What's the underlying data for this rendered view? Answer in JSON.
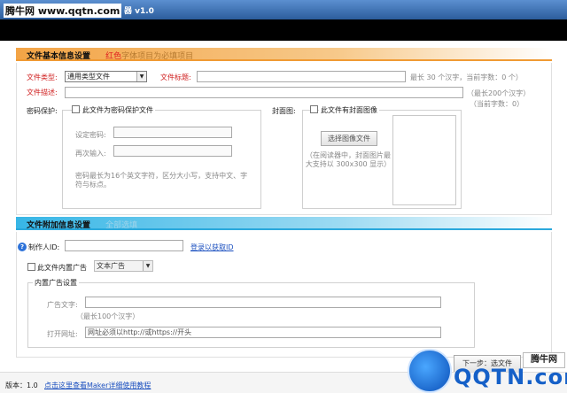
{
  "titlebar": {
    "site": "腾牛网 www.qqtn.com",
    "version": "器 v1.0"
  },
  "section1": {
    "title": "文件基本信息设置",
    "note_red": "红色",
    "note_rest": "字体项目为必填项目"
  },
  "file_type": {
    "label": "文件类型:",
    "value": "通用类型文件"
  },
  "file_title": {
    "label": "文件标题:",
    "hint": "最长 30 个汉字，当前字数：0 个）"
  },
  "file_desc": {
    "label": "文件描述:",
    "hint": "（最长200个汉字）",
    "hint2": "（当前字数：0）"
  },
  "password": {
    "label": "密码保护:",
    "checkbox": "此文件为密码保护文件",
    "set_label": "设定密码:",
    "repeat_label": "再次输入:",
    "note": "密码最长为16个英文字符，区分大小写，支持中文、字符与标点。"
  },
  "cover": {
    "label": "封面图:",
    "checkbox": "此文件有封面图像",
    "button": "选择图像文件",
    "note": "（在阅读器中，封面图片最大支持以 300x300 显示）"
  },
  "section2": {
    "title": "文件附加信息设置",
    "note": "全部选填"
  },
  "maker_id": {
    "label": "制作人ID:",
    "link": "登录以获取ID"
  },
  "ad": {
    "checkbox": "此文件内置广告",
    "select": "文本广告",
    "group_title": "内置广告设置",
    "text_label": "广告文字:",
    "text_hint": "（最长100个汉字）",
    "url_label": "打开网址:",
    "url_value": "网址必须以http://或https://开头"
  },
  "next_button": "下一步：选文件",
  "status": {
    "version": "版本：1.0",
    "link": "点击这里查看Maker详细使用教程"
  },
  "watermark": {
    "text": "QQTN.com",
    "badge": "腾牛网"
  }
}
